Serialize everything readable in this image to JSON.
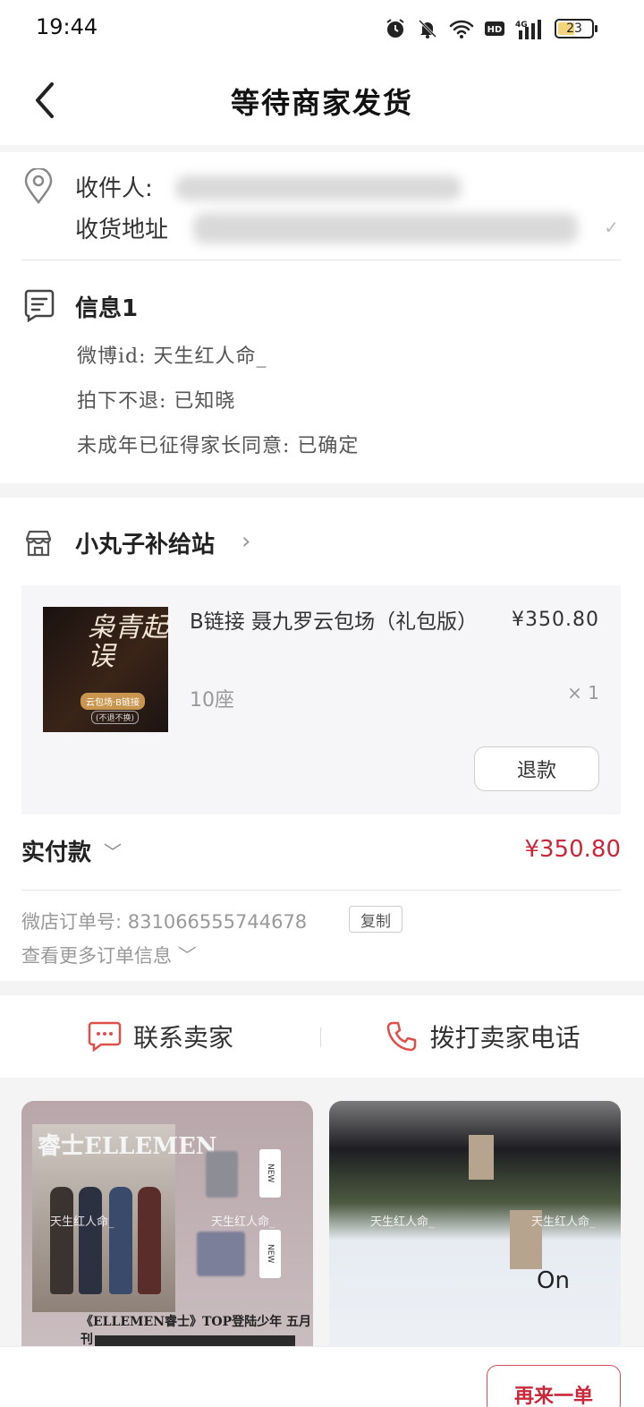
{
  "status_bar": {
    "time": "19:44",
    "battery": "23"
  },
  "header": {
    "title": "等待商家发货"
  },
  "address": {
    "recipient_label": "收件人:",
    "address_label": "收货地址"
  },
  "info": {
    "title": "信息1",
    "rows": [
      "微博id: 天生红人命_",
      "拍下不退: 已知晓",
      "未成年已征得家长同意: 已确定"
    ]
  },
  "store": {
    "name": "小丸子补给站"
  },
  "item": {
    "title": "B链接 聂九罗云包场（礼包版）",
    "spec": "10座",
    "price": "¥350.80",
    "qty": "× 1",
    "refund_label": "退款",
    "thumb_text": "枭青起误",
    "thumb_tag": "云包场·B链接",
    "thumb_note": "(不退不换)"
  },
  "payment": {
    "label": "实付款",
    "amount": "¥350.80"
  },
  "order": {
    "number_text": "微店订单号: 831066555744678",
    "copy_label": "复制",
    "more_label": "查看更多订单信息"
  },
  "contact": {
    "chat_label": "联系卖家",
    "call_label": "拨打卖家电话"
  },
  "recommend": {
    "magazine_title": "睿士ELLEMEN",
    "caption": "《ELLEMEN睿士》TOP登陆少年 五月刊",
    "card_tag": "NEW",
    "watermark": "天生红人命_",
    "brand_mark": "On"
  },
  "bottom": {
    "again_label": "再来一单"
  },
  "colors": {
    "accent": "#c8283a",
    "icon_red": "#e0504a"
  }
}
